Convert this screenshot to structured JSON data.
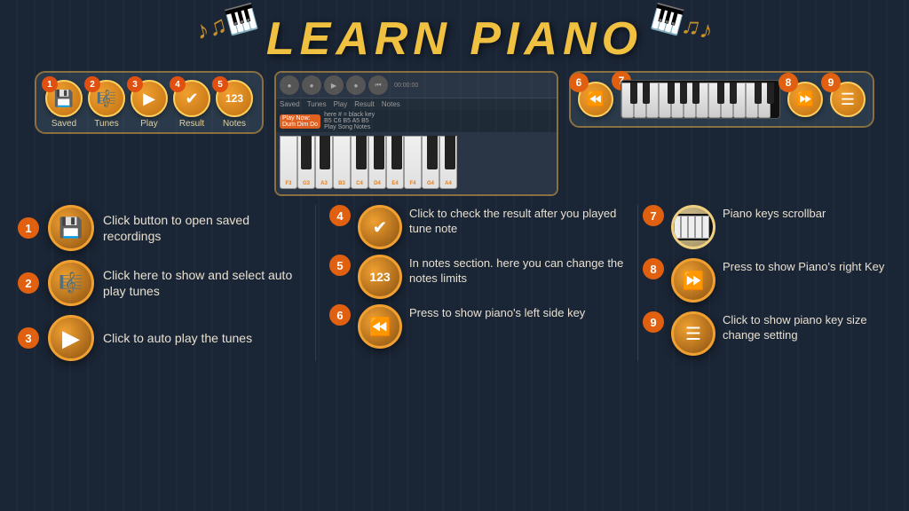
{
  "title": "LEARN PIANO",
  "toolbar": {
    "items": [
      {
        "num": "1",
        "label": "Saved",
        "icon": "💾"
      },
      {
        "num": "2",
        "label": "Tunes",
        "icon": "🎼"
      },
      {
        "num": "3",
        "label": "Play",
        "icon": "▶"
      },
      {
        "num": "4",
        "label": "Result",
        "icon": "✔"
      },
      {
        "num": "5",
        "label": "Notes",
        "icon": "123"
      }
    ]
  },
  "piano_display": {
    "play_now": "Play Now:",
    "song": "Dum Dim Do",
    "note_hint": "here # = black key",
    "notes_row": "B5 C6 B5 A5  B5",
    "sub_label": "Play Song Notes"
  },
  "right_controls": {
    "rewind_icon": "⏪",
    "forward_icon": "⏩",
    "menu_icon": "☰",
    "badge_6": "6",
    "badge_7": "7",
    "badge_8": "8",
    "badge_9": "9"
  },
  "callouts": {
    "left": [
      {
        "num": "1",
        "icon": "💾",
        "text": "Click button to open saved recordings"
      },
      {
        "num": "2",
        "icon": "🎼",
        "text": "Click here to show and select  auto play tunes"
      },
      {
        "num": "3",
        "icon": "▶",
        "text": "Click to auto play the tunes"
      }
    ],
    "middle": [
      {
        "num": "4",
        "icon": "✔",
        "text": "Click to check the result after you played tune note"
      },
      {
        "num": "5",
        "icon": "123",
        "text": "In notes section. here you can change the notes limits"
      },
      {
        "num": "6",
        "icon": "⏪",
        "text": "Press to show piano's left side key"
      }
    ],
    "right": [
      {
        "num": "7",
        "icon": "piano",
        "text": "Piano keys scrollbar"
      },
      {
        "num": "8",
        "icon": "⏩",
        "text": "Press to show Piano's right Key"
      },
      {
        "num": "9",
        "icon": "☰",
        "text": "Click to show  piano key size change setting"
      }
    ]
  }
}
